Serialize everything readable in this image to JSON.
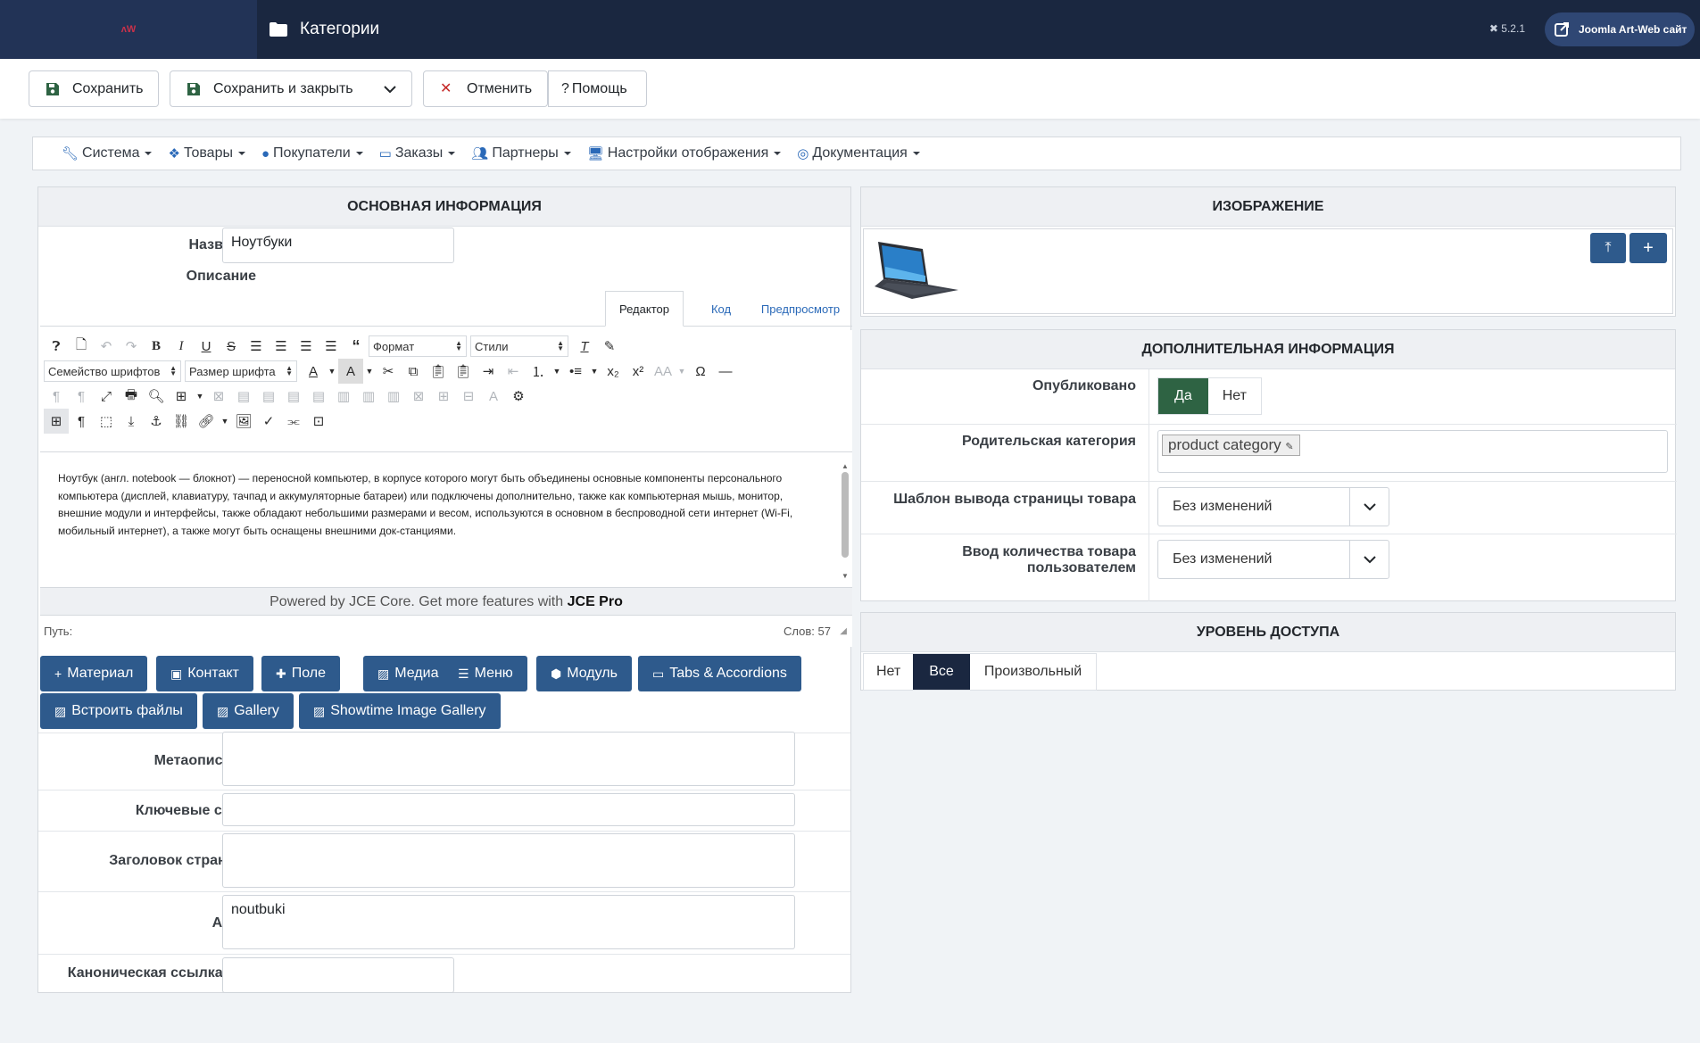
{
  "header": {
    "title": "Категории",
    "version": "5.2.1",
    "site_link": "Joomla Art-Web сайт"
  },
  "toolbar": {
    "save": "Сохранить",
    "save_close": "Сохранить и закрыть",
    "cancel": "Отменить",
    "help": "Помощь"
  },
  "menu": [
    {
      "label": "Система",
      "icon": "wrench-icon"
    },
    {
      "label": "Товары",
      "icon": "cubes-icon"
    },
    {
      "label": "Покупатели",
      "icon": "user-icon"
    },
    {
      "label": "Заказы",
      "icon": "credit-card-icon"
    },
    {
      "label": "Партнеры",
      "icon": "users-icon"
    },
    {
      "label": "Настройки отображения",
      "icon": "desktop-icon"
    },
    {
      "label": "Документация",
      "icon": "lifebuoy-icon"
    }
  ],
  "main": {
    "title": "ОСНОВНАЯ ИНФОРМАЦИЯ",
    "name_label": "Название",
    "name_value": "Ноутбуки",
    "desc_label": "Описание",
    "tabs": [
      "Редактор",
      "Код",
      "Предпросмотр"
    ],
    "font_family": "Семейство шрифтов",
    "font_size": "Размер шрифта",
    "format": "Формат",
    "styles": "Стили",
    "text": "Ноутбук (англ. notebook — блокнот) — переносной компьютер, в корпусе которого могут быть объединены основные компоненты персонального компьютера (дисплей, клавиатуру, тачпад и аккумуляторные батареи) или подключены дополнительно, также как компьютерная мышь, монитор, внешние модули и интерфейсы, также обладают небольшими размерами и весом, используются в основном в беспроводной сети интернет (Wi-Fi, мобильный интернет), а также могут быть оснащены внешними док-станциями.",
    "powered_prefix": "Powered by JCE Core. Get more features with",
    "powered_link": "JCE Pro",
    "path_label": "Путь:",
    "word_count": "Слов: 57",
    "insert_buttons": [
      "Материал",
      "Контакт",
      "Поле",
      "Медиа",
      "Меню",
      "Модуль",
      "Tabs & Accordions",
      "Встроить файлы",
      "Gallery",
      "Showtime Image Gallery"
    ],
    "meta_desc_label": "Метаописание",
    "keywords_label": "Ключевые слова",
    "page_title_label": "Заголовок страницы",
    "alias_label": "Алиас",
    "alias_value": "noutbuki",
    "canonical_label": "Каноническая ссылка URL"
  },
  "image_panel": {
    "title": "ИЗОБРАЖЕНИЕ"
  },
  "extra": {
    "title": "ДОПОЛНИТЕЛЬНАЯ ИНФОРМАЦИЯ",
    "published_label": "Опубликовано",
    "yes": "Да",
    "no": "Нет",
    "parent_label": "Родительская категория",
    "parent_value": "product category",
    "template_label": "Шаблон вывода страницы товара",
    "template_value": "Без изменений",
    "qty_label": "Ввод количества товара пользователем",
    "qty_value": "Без изменений"
  },
  "access": {
    "title": "УРОВЕНЬ ДОСТУПА",
    "options": [
      "Нет",
      "Все",
      "Произвольный"
    ]
  },
  "colors": {
    "header": "#1a2740",
    "accent": "#2a69b8",
    "publish_yes": "#2e6343",
    "insert_btn": "#2e5a8c"
  }
}
